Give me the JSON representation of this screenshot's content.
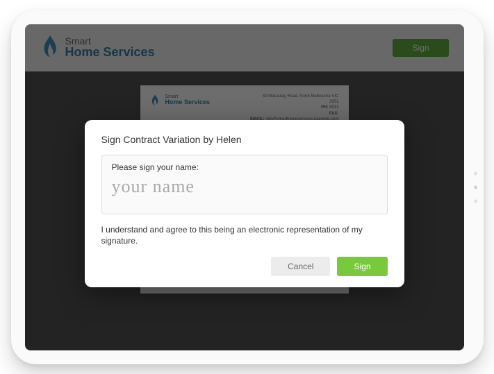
{
  "brand": {
    "line1": "Smart",
    "line2": "Home Services"
  },
  "header": {
    "sign_label": "Sign"
  },
  "doc": {
    "address": "40 Macaulay Road, North Melbourne  VIC",
    "postcode": "3051",
    "phone_label": "PH:",
    "phone": "8031",
    "fax_label": "FAX:",
    "email_label": "EMAIL:",
    "email": "info@smarthomeservices.example.com"
  },
  "modal": {
    "title": "Sign Contract Variation by Helen",
    "sign_label": "Please sign your name:",
    "placeholder": "your name",
    "consent": "I understand and agree to this being an electronic representation of my signature.",
    "cancel_label": "Cancel",
    "sign_btn_label": "Sign"
  }
}
